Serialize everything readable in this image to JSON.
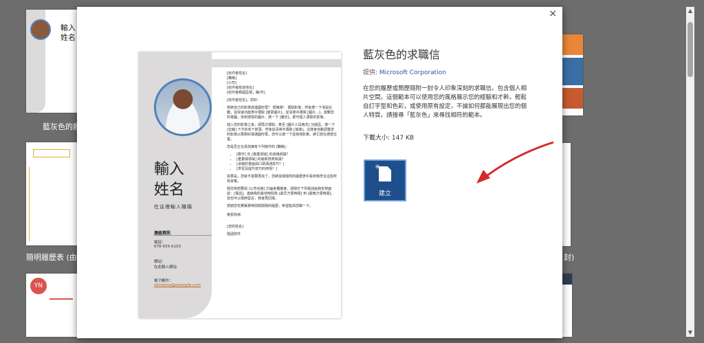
{
  "gallery": {
    "captions": [
      "藍灰色的履歷",
      "簡明履歷表 (由 M",
      "封)"
    ],
    "thumb_text": [
      "輸入",
      "姓名",
      "YN"
    ]
  },
  "dialog": {
    "close": "×",
    "nav_prev": "←",
    "nav_next": "→"
  },
  "template": {
    "title": "藍灰色的求職信",
    "provider_label": "提供:",
    "provider": "Microsoft Corporation",
    "description": "在您的履歷或簡歷隨附一封令人印象深刻的求職信。包含個人相片空間，這個範本可以使用您的風格展示您的經驗和才幹。輕鬆自訂字型和色彩，或使用原有設定，不論如何都能展現出您的個人特質。請搜尋「藍灰色」來尋找相符的範本。",
    "size_label": "下載大小:",
    "size_value": "147 KB",
    "create_label": "建立"
  },
  "preview": {
    "name_line1": "輸入",
    "name_line2": "姓名",
    "subtitle": "在這裡輸入職稱",
    "contact_heading": "連絡資訊",
    "phone_label": "電話：",
    "phone": "678-555-0103",
    "web_label": "網站：",
    "web": "在此輸入網站",
    "email_label": "電子郵件：",
    "email": "someone@example.com",
    "header_lines": [
      "[收件者姓名]",
      "[職稱]",
      "[公司]",
      "[收件者街道地址]",
      "[收件者郵遞區號，縣/市]"
    ],
    "greeting": "[收件者姓名]，您好：",
    "para1": "想將自己的影像放進圓形框？ 很簡單！ 選取影像，然後按一下滑鼠右鍵，從快速功能表中選取 [變更圖片]。從清單中選擇 [圖片...]，瀏覽您的電腦，找到適當的圖片，按一下 [確定]，即可插入選取的影像。",
    "para2": "插入您的影像之後，請再次選取，移至 [圖片工具格式] 功能區，按一下 [剪裁] 下方的向下箭頭，然後從清單中選取 [填滿]。這樣會自動調整您的影像以剛剛好填滿圓形框，您可以按一下並拖曳影像，將它放在適當位置。",
    "para3": "您是否正在尋找擁有下列條件的 [職稱]：",
    "bullets": [
      "[數字] 年 [專業領域] 的資格經驗？",
      "[產業或領域] 的最新技術知識？",
      "[卓越的書面與口頭溝通技巧？]",
      "[學習及提升技巧的熱情？]"
    ],
    "para4": "如果是，您就不需要再找了。您將從我隨附的履歷表中看到我符合這些所有資格。",
    "para5": "我非常想要與 [公司名稱] 討論各種機會。請撥打下列電話給我安排面試：[電話]。連絡我的最佳時間為 [最早方便時間] 到 [最晚方便時間]，但也可以隨時留言，我會再回電。",
    "para6": "感謝您花費寶貴時間檢閱我的履歷，希望能與您聊一下。",
    "closing": "敬祝商祺",
    "signature": "[您的姓名]",
    "enclosure": "隨函附件"
  },
  "colors": {
    "accent": "#1e4e8c",
    "link": "#2b579a",
    "annotation_arrow": "#d42a2a"
  }
}
